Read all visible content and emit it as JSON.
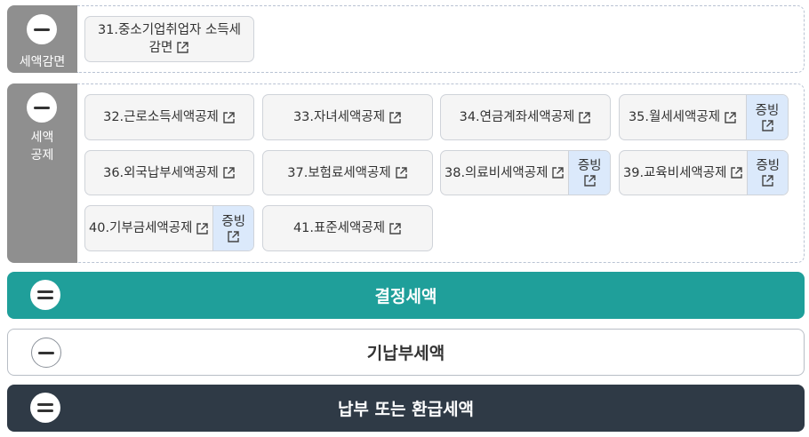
{
  "sections": {
    "reduction": {
      "label": "세액감면",
      "items": [
        {
          "line1": "31.중소기업취업자 소득세",
          "line2": "감면"
        }
      ]
    },
    "deduction": {
      "label_line1": "세액",
      "label_line2": "공제",
      "items": [
        {
          "label": "32.근로소득세액공제"
        },
        {
          "label": "33.자녀세액공제"
        },
        {
          "label": "34.연금계좌세액공제"
        },
        {
          "label": "35.월세세액공제",
          "proof": "증빙"
        },
        {
          "label": "36.외국납부세액공제"
        },
        {
          "label": "37.보험료세액공제"
        },
        {
          "label": "38.의료비세액공제",
          "proof": "증빙"
        },
        {
          "label": "39.교육비세액공제",
          "proof": "증빙"
        },
        {
          "label": "40.기부금세액공제",
          "proof": "증빙"
        },
        {
          "label": "41.표준세액공제"
        }
      ]
    }
  },
  "totals": {
    "determined": {
      "label": "결정세액",
      "color": "#1f9f9a"
    },
    "prepaid": {
      "label": "기납부세액"
    },
    "final": {
      "label": "납부 또는 환급세액",
      "color": "#2f3a46"
    }
  },
  "icons": {
    "collapse": "minus-circle-icon",
    "equals": "equals-circle-icon",
    "external": "external-link-icon"
  }
}
